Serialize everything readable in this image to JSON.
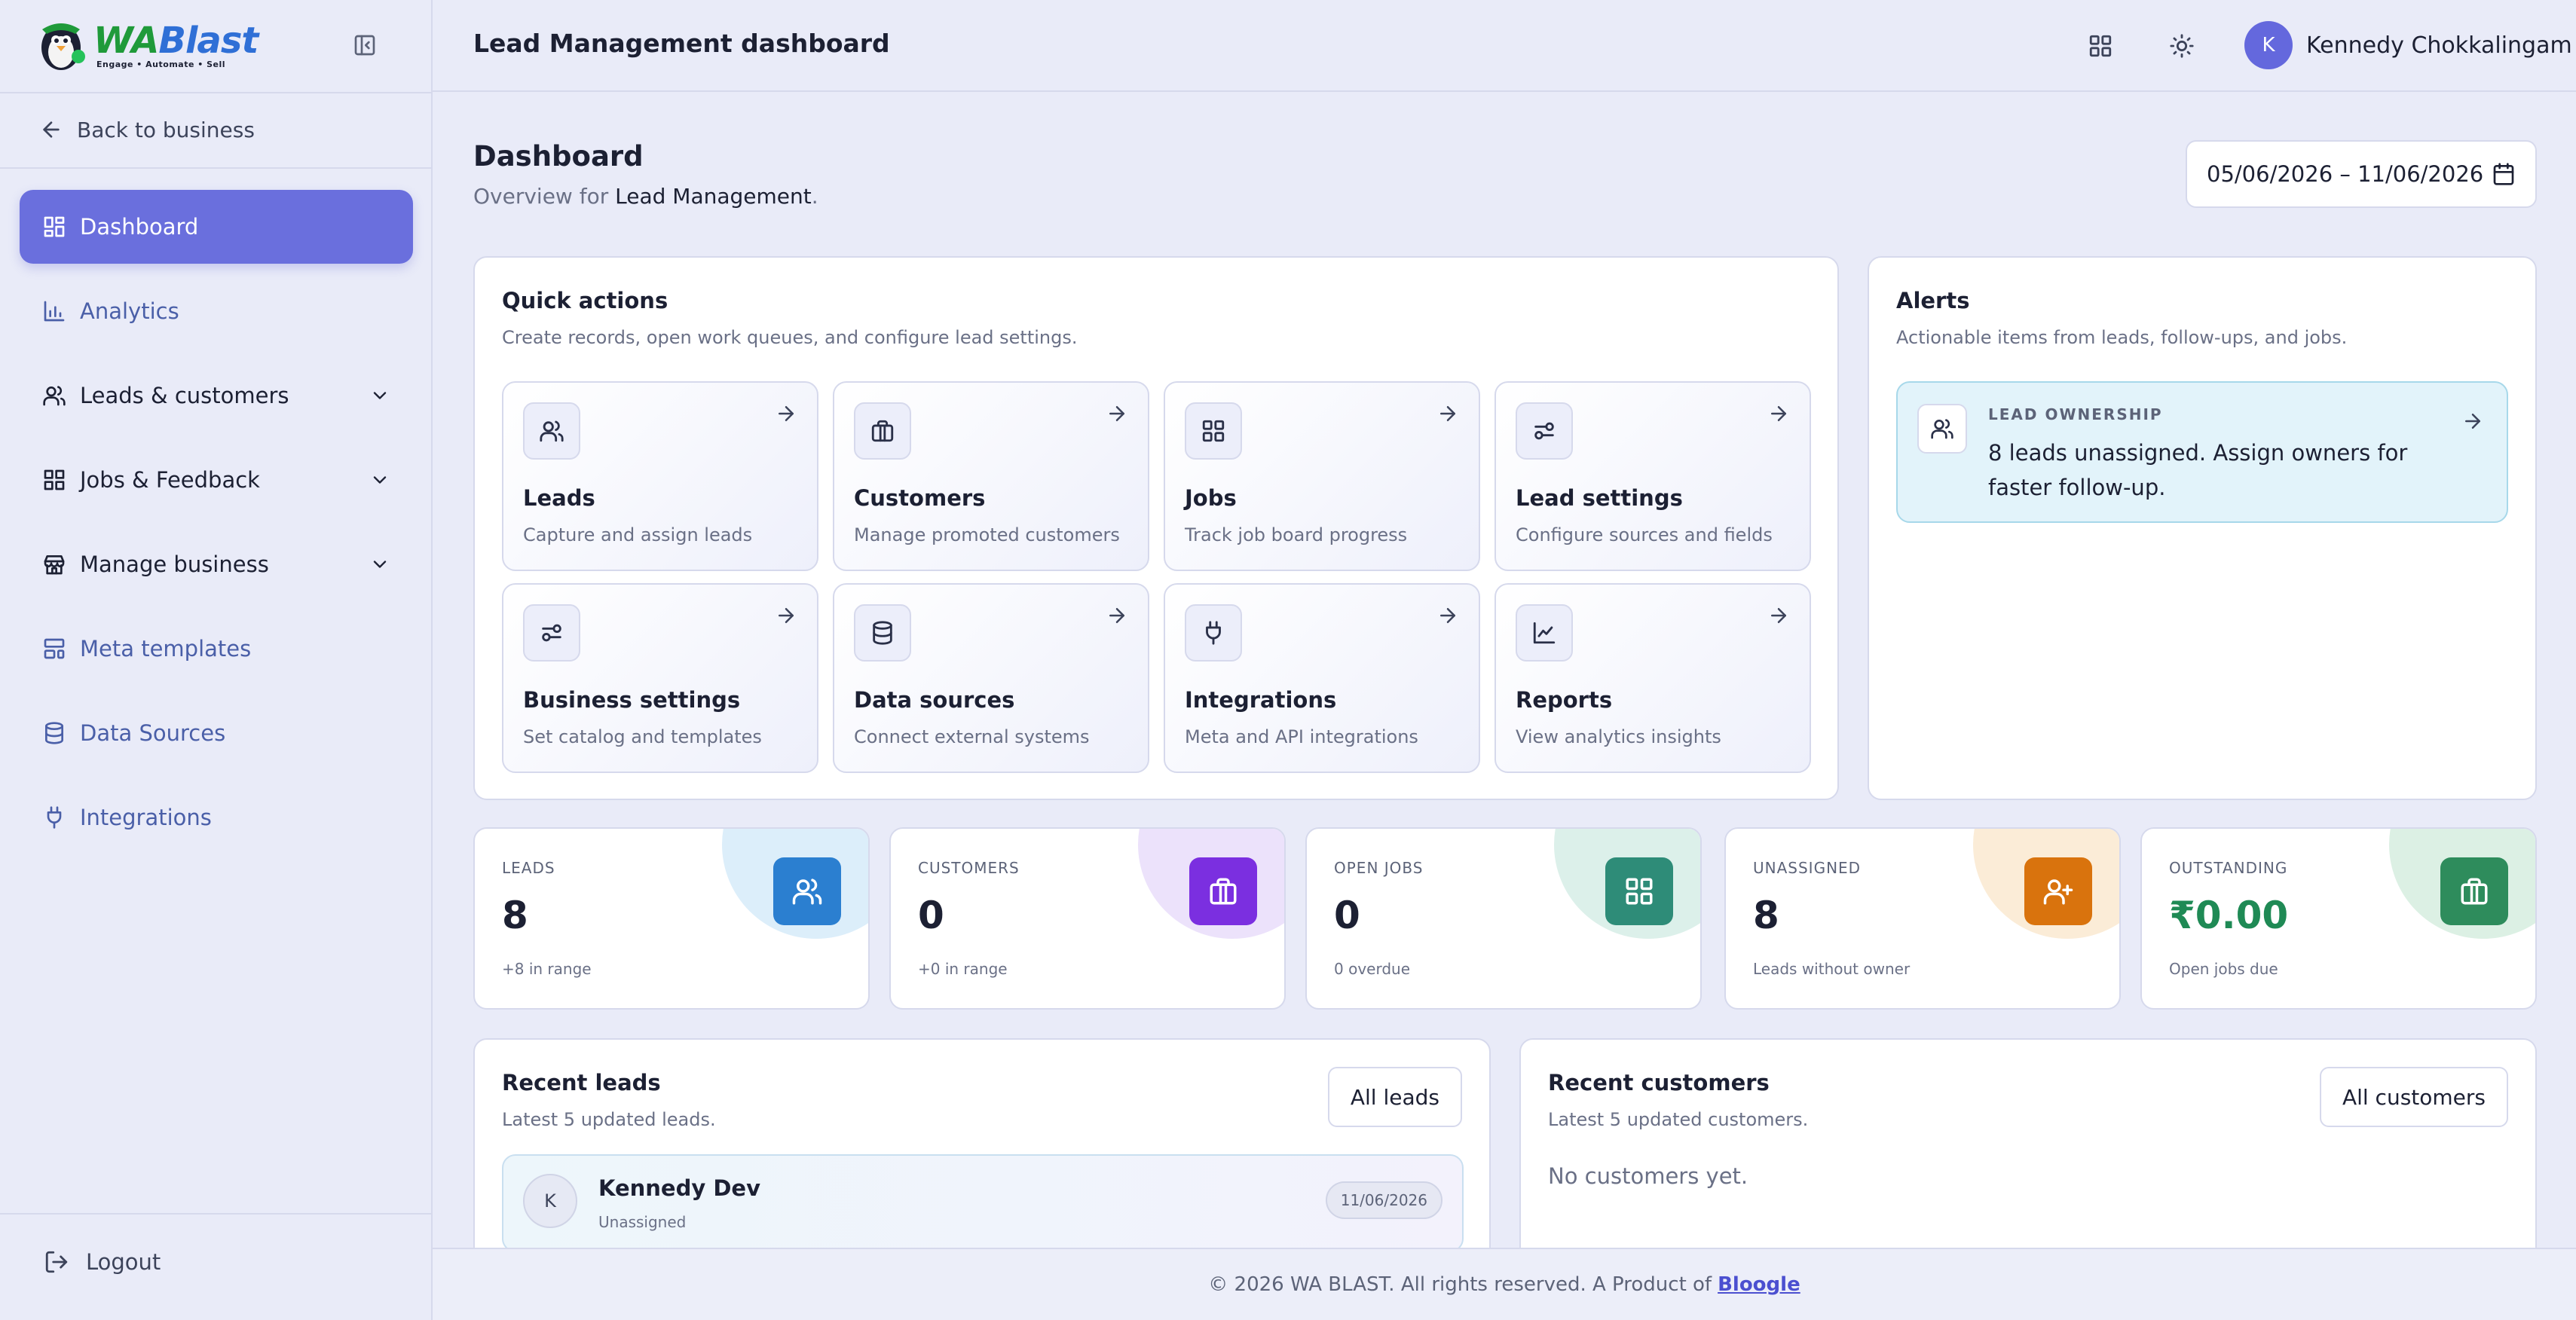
{
  "brand": {
    "name_part1": "WA",
    "name_part2": "Blast",
    "tagline": "Engage • Automate • Sell"
  },
  "sidebar": {
    "back_label": "Back to business",
    "items": [
      {
        "label": "Dashboard",
        "icon": "dashboard-grid-icon"
      },
      {
        "label": "Analytics",
        "icon": "bar-chart-icon"
      },
      {
        "label": "Leads & customers",
        "icon": "users-icon"
      },
      {
        "label": "Jobs & Feedback",
        "icon": "grid-icon"
      },
      {
        "label": "Manage business",
        "icon": "store-icon"
      },
      {
        "label": "Meta templates",
        "icon": "template-icon"
      },
      {
        "label": "Data Sources",
        "icon": "database-icon"
      },
      {
        "label": "Integrations",
        "icon": "plug-icon"
      }
    ],
    "logout_label": "Logout"
  },
  "header": {
    "title": "Lead Management dashboard",
    "user": {
      "initial": "K",
      "name": "Kennedy Chokkalingam"
    }
  },
  "page": {
    "title": "Dashboard",
    "subtitle_prefix": "Overview for ",
    "subtitle_bold": "Lead Management",
    "subtitle_suffix": ".",
    "date_range": "05/06/2026 – 11/06/2026"
  },
  "quick_actions": {
    "title": "Quick actions",
    "subtitle": "Create records, open work queues, and configure lead settings.",
    "tiles": [
      {
        "title": "Leads",
        "desc": "Capture and assign leads",
        "icon": "users-icon"
      },
      {
        "title": "Customers",
        "desc": "Manage promoted customers",
        "icon": "briefcase-icon"
      },
      {
        "title": "Jobs",
        "desc": "Track job board progress",
        "icon": "grid-icon"
      },
      {
        "title": "Lead settings",
        "desc": "Configure sources and fields",
        "icon": "sliders-icon"
      },
      {
        "title": "Business settings",
        "desc": "Set catalog and templates",
        "icon": "sliders-icon"
      },
      {
        "title": "Data sources",
        "desc": "Connect external systems",
        "icon": "database-icon"
      },
      {
        "title": "Integrations",
        "desc": "Meta and API integrations",
        "icon": "plug-icon"
      },
      {
        "title": "Reports",
        "desc": "View analytics insights",
        "icon": "line-chart-icon"
      }
    ]
  },
  "alerts": {
    "title": "Alerts",
    "subtitle": "Actionable items from leads, follow-ups, and jobs.",
    "items": [
      {
        "kicker": "LEAD OWNERSHIP",
        "text": "8 leads unassigned. Assign owners for faster follow-up."
      }
    ]
  },
  "stats": [
    {
      "label": "LEADS",
      "value": "8",
      "note": "+8 in range",
      "color": "#2b7fd0",
      "blob": "#dceefa"
    },
    {
      "label": "CUSTOMERS",
      "value": "0",
      "note": "+0 in range",
      "color": "#7b2fe0",
      "blob": "#ece2fb"
    },
    {
      "label": "OPEN JOBS",
      "value": "0",
      "note": "0 overdue",
      "color": "#2e8c78",
      "blob": "#dcf0ea"
    },
    {
      "label": "UNASSIGNED",
      "value": "8",
      "note": "Leads without owner",
      "color": "#d9730d",
      "blob": "#fbecd7"
    },
    {
      "label": "OUTSTANDING",
      "value": "₹0.00",
      "note": "Open jobs due",
      "color": "#2e8c5c",
      "blob": "#dcf0e4"
    }
  ],
  "recent_leads": {
    "title": "Recent leads",
    "subtitle": "Latest 5 updated leads.",
    "button": "All leads",
    "rows": [
      {
        "initial": "K",
        "name": "Kennedy Dev",
        "owner": "Unassigned",
        "date": "11/06/2026"
      }
    ]
  },
  "recent_customers": {
    "title": "Recent customers",
    "subtitle": "Latest 5 updated customers.",
    "button": "All customers",
    "empty": "No customers yet."
  },
  "footer": {
    "text": "© 2026 WA BLAST. All rights reserved. A Product of",
    "link": "Bloogle"
  },
  "colors": {
    "accent": "#6a6fdd",
    "background": "#e9ebf8"
  }
}
